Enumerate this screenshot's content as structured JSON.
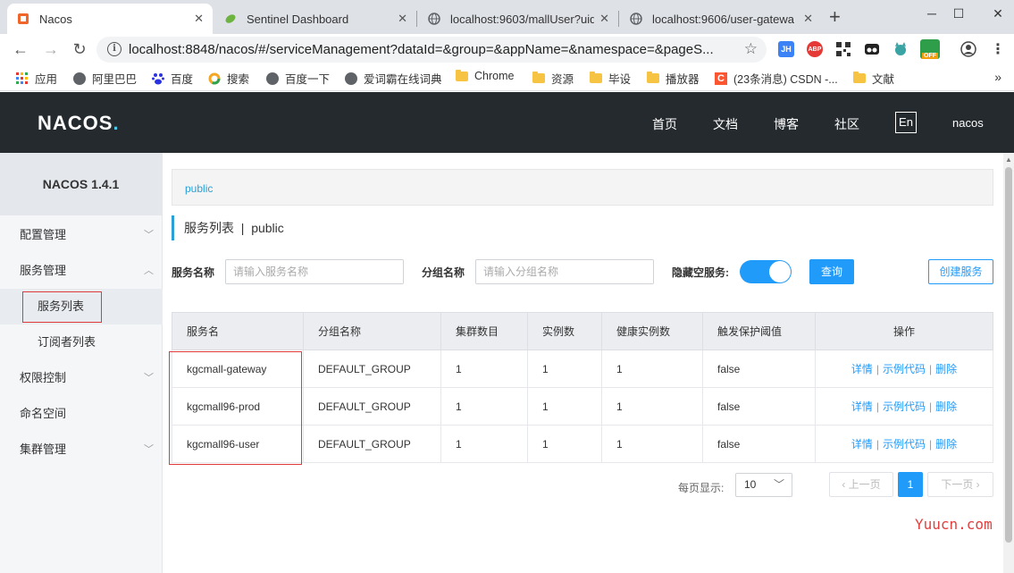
{
  "browser": {
    "tabs": [
      {
        "title": "Nacos",
        "active": true
      },
      {
        "title": "Sentinel Dashboard",
        "active": false
      },
      {
        "title": "localhost:9603/mallUser?uid",
        "active": false
      },
      {
        "title": "localhost:9606/user-gatewa",
        "active": false
      }
    ],
    "url": "localhost:8848/nacos/#/serviceManagement?dataId=&group=&appName=&namespace=&pageS...",
    "url_host": "localhost",
    "bookmarks": [
      {
        "label": "应用",
        "icon": "apps-grid-icon"
      },
      {
        "label": "阿里巴巴",
        "icon": "globe-icon"
      },
      {
        "label": "百度",
        "icon": "baidu-paw-icon"
      },
      {
        "label": "搜索",
        "icon": "search-ring-icon"
      },
      {
        "label": "百度一下",
        "icon": "globe-icon"
      },
      {
        "label": "爱词霸在线词典",
        "icon": "globe-icon"
      },
      {
        "label": "Chrome",
        "icon": "folder-icon"
      },
      {
        "label": "资源",
        "icon": "folder-icon"
      },
      {
        "label": "毕设",
        "icon": "folder-icon"
      },
      {
        "label": "播放器",
        "icon": "folder-icon"
      },
      {
        "label": "(23条消息) CSDN -...",
        "icon": "csdn-icon"
      },
      {
        "label": "文献",
        "icon": "folder-icon"
      }
    ],
    "extensions": [
      "JH",
      "ABP",
      "OFF"
    ]
  },
  "header": {
    "logo": "NACOS",
    "nav": [
      "首页",
      "文档",
      "博客",
      "社区"
    ],
    "lang": "En",
    "user": "nacos"
  },
  "sidebar": {
    "version": "NACOS 1.4.1",
    "items": [
      {
        "label": "配置管理",
        "expandable": true
      },
      {
        "label": "服务管理",
        "expandable": true
      },
      {
        "label": "服务列表",
        "sub": true,
        "selected": true
      },
      {
        "label": "订阅者列表",
        "sub": true
      },
      {
        "label": "权限控制",
        "expandable": true
      },
      {
        "label": "命名空间"
      },
      {
        "label": "集群管理",
        "expandable": true
      }
    ]
  },
  "main": {
    "namespace_crumb": "public",
    "title": "服务列表",
    "title_sep": "|",
    "title_ns": "public",
    "filters": {
      "service_name_label": "服务名称",
      "service_name_placeholder": "请输入服务名称",
      "group_name_label": "分组名称",
      "group_name_placeholder": "请输入分组名称",
      "hide_empty_label": "隐藏空服务:",
      "hide_empty_on": true,
      "query_button": "查询",
      "create_button": "创建服务"
    },
    "table": {
      "columns": [
        "服务名",
        "分组名称",
        "集群数目",
        "实例数",
        "健康实例数",
        "触发保护阈值",
        "操作"
      ],
      "rows": [
        {
          "name": "kgcmall-gateway",
          "group": "DEFAULT_GROUP",
          "clusters": "1",
          "instances": "1",
          "healthy": "1",
          "threshold": "false"
        },
        {
          "name": "kgcmall96-prod",
          "group": "DEFAULT_GROUP",
          "clusters": "1",
          "instances": "1",
          "healthy": "1",
          "threshold": "false"
        },
        {
          "name": "kgcmall96-user",
          "group": "DEFAULT_GROUP",
          "clusters": "1",
          "instances": "1",
          "healthy": "1",
          "threshold": "false"
        }
      ],
      "actions": [
        "详情",
        "示例代码",
        "删除"
      ],
      "action_sep": "|"
    },
    "pagination": {
      "per_page_label": "每页显示:",
      "per_page": "10",
      "prev": "上一页",
      "current": "1",
      "next": "下一页"
    }
  },
  "watermark": "Yuucn.com",
  "colors": {
    "accent": "#209bfa",
    "header_bg": "#252a2f",
    "highlight_box": "#e03a3a"
  }
}
